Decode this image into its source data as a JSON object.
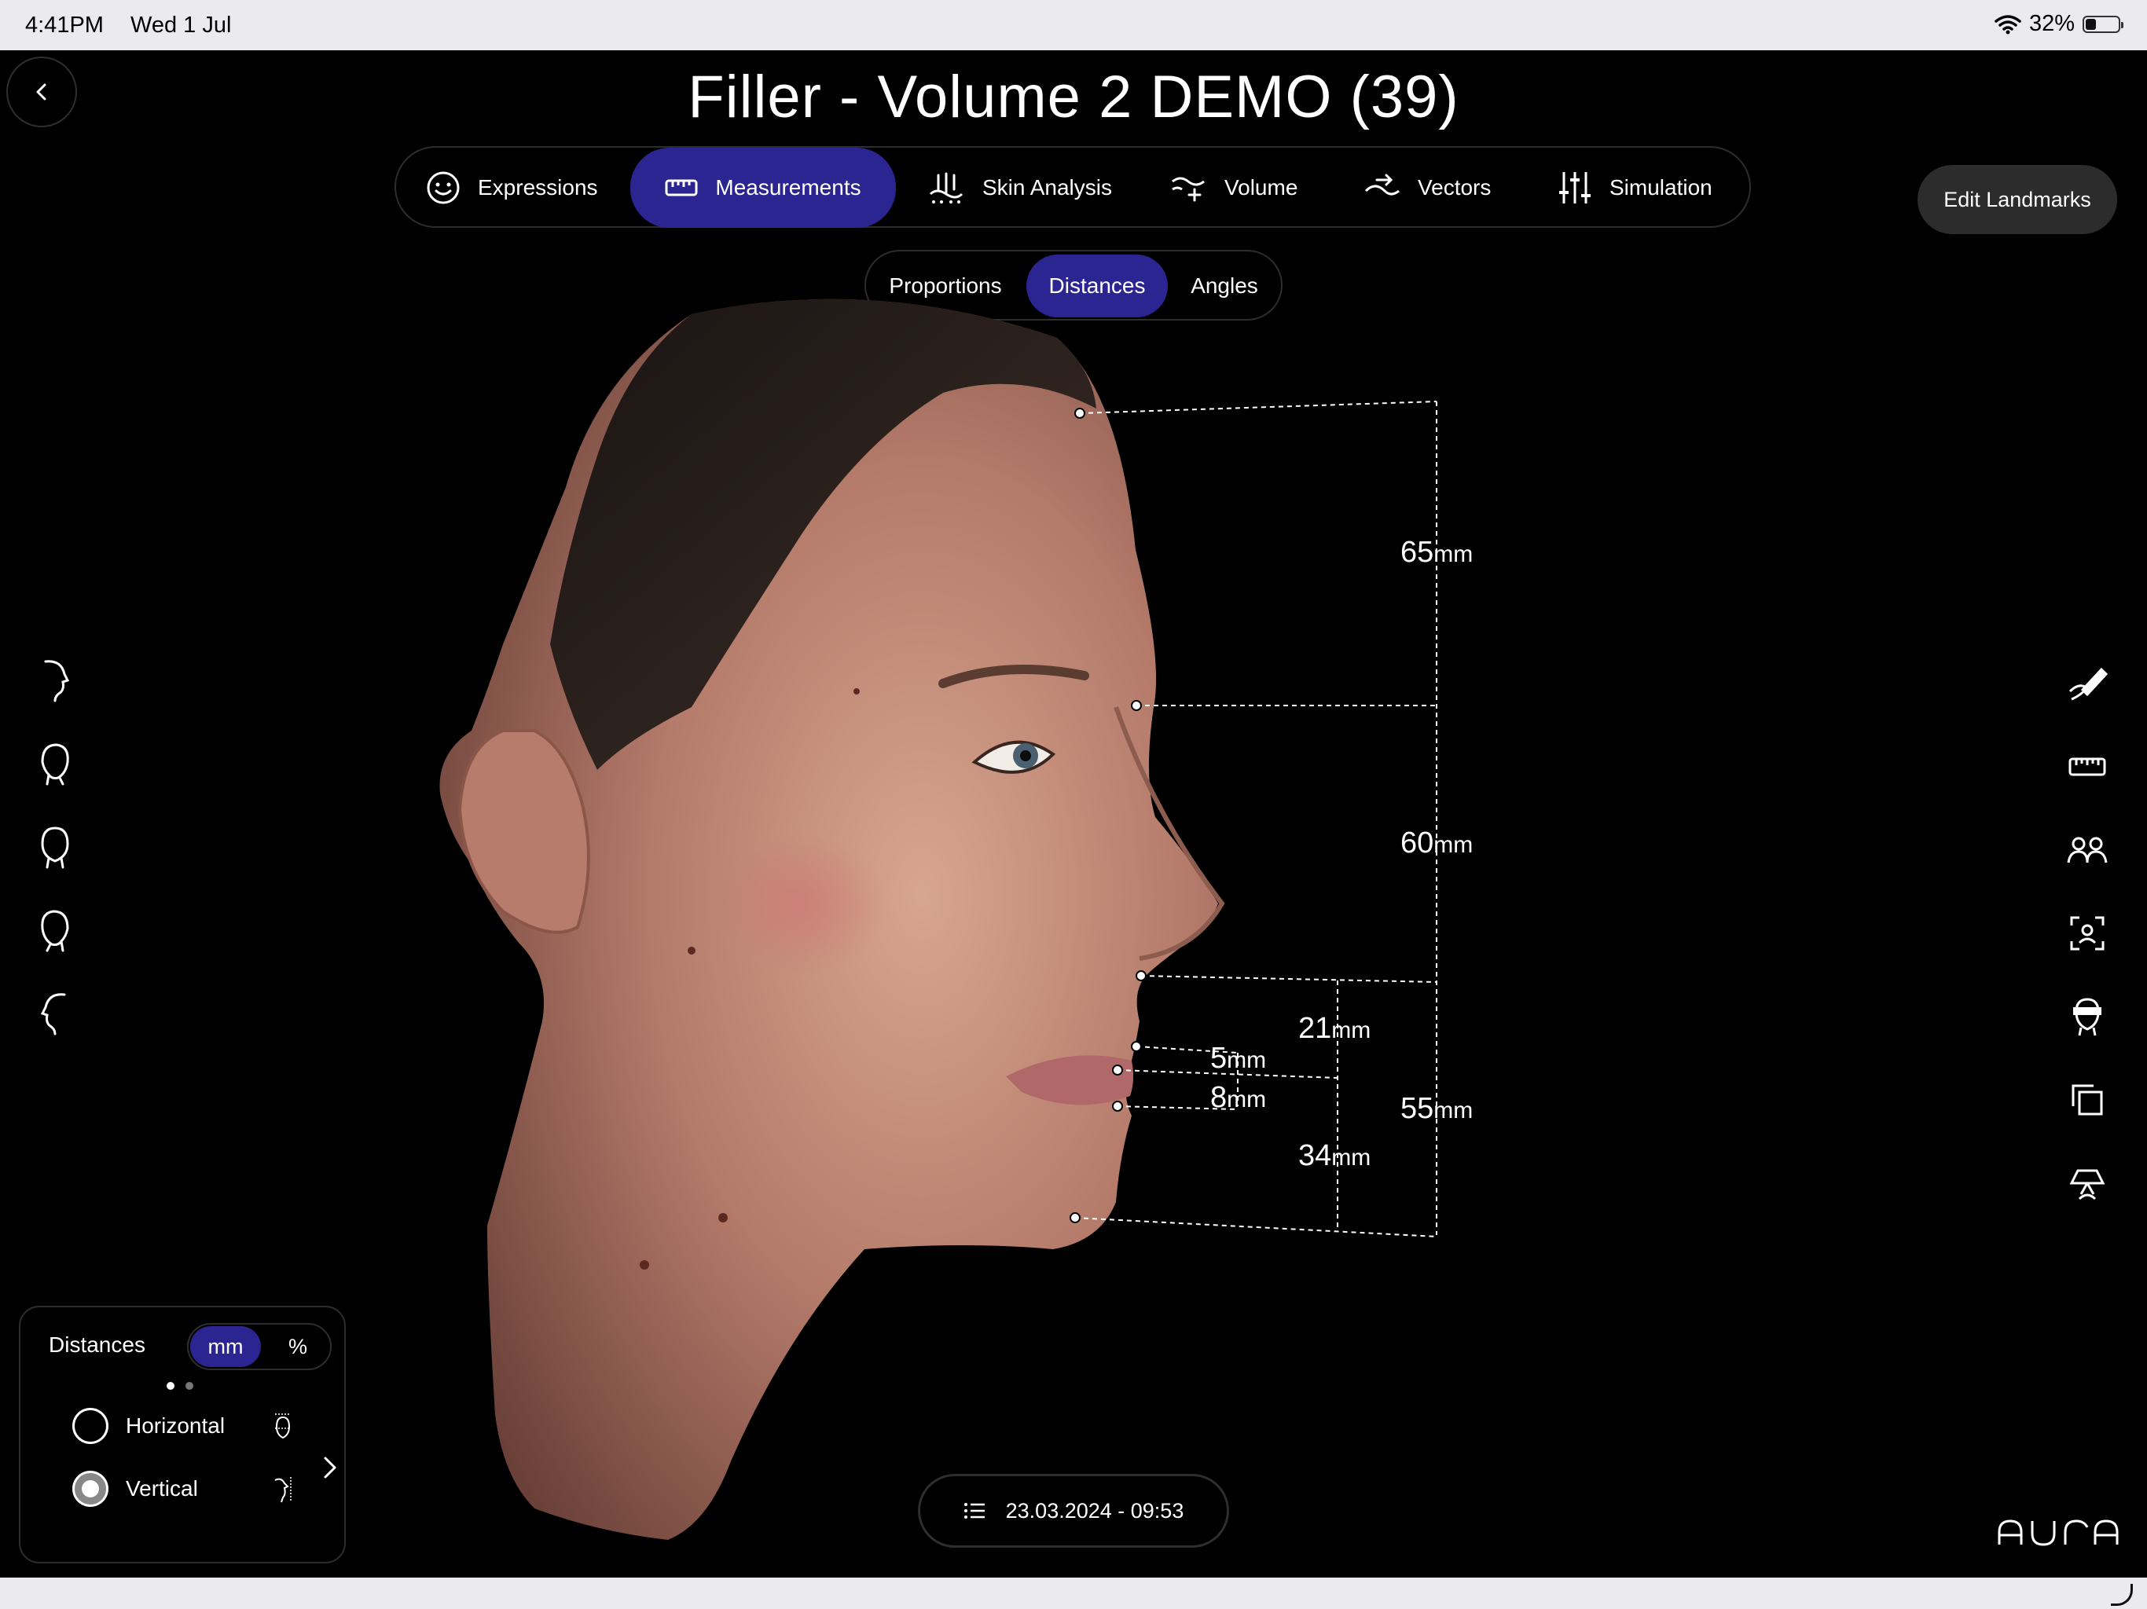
{
  "status_bar": {
    "time": "4:41PM",
    "date": "Wed 1 Jul",
    "battery_text": "32%",
    "battery_level": 0.32
  },
  "header": {
    "title": "Filler - Volume 2 DEMO (39)"
  },
  "main_tabs": [
    {
      "label": "Expressions",
      "icon": "smiley-icon",
      "active": false
    },
    {
      "label": "Measurements",
      "icon": "ruler-icon",
      "active": true
    },
    {
      "label": "Skin Analysis",
      "icon": "skin-analysis-icon",
      "active": false
    },
    {
      "label": "Volume",
      "icon": "volume-icon",
      "active": false
    },
    {
      "label": "Vectors",
      "icon": "vectors-icon",
      "active": false
    },
    {
      "label": "Simulation",
      "icon": "sliders-icon",
      "active": false
    }
  ],
  "edit_landmarks_label": "Edit Landmarks",
  "sub_tabs": [
    {
      "label": "Proportions",
      "active": false
    },
    {
      "label": "Distances",
      "active": true
    },
    {
      "label": "Angles",
      "active": false
    }
  ],
  "measurements": [
    {
      "value": "65",
      "unit": "mm"
    },
    {
      "value": "60",
      "unit": "mm"
    },
    {
      "value": "21",
      "unit": "mm"
    },
    {
      "value": "5",
      "unit": "mm"
    },
    {
      "value": "8",
      "unit": "mm"
    },
    {
      "value": "55",
      "unit": "mm"
    },
    {
      "value": "34",
      "unit": "mm"
    }
  ],
  "left_views": [
    "profile-right-icon",
    "three-quarter-right-icon",
    "front-face-icon",
    "three-quarter-left-icon",
    "profile-left-icon"
  ],
  "right_tools": [
    "draw-icon",
    "ruler-icon",
    "compare-people-icon",
    "face-scan-icon",
    "face-mask-icon",
    "copy-icon",
    "lamp-icon"
  ],
  "distances_panel": {
    "title": "Distances",
    "units": [
      {
        "label": "mm",
        "active": true
      },
      {
        "label": "%",
        "active": false
      }
    ],
    "options": [
      {
        "label": "Horizontal",
        "checked": false
      },
      {
        "label": "Vertical",
        "checked": true
      }
    ]
  },
  "session": {
    "datetime": "23.03.2024 - 09:53"
  },
  "brand": "AURA",
  "colors": {
    "accent": "#2b2592",
    "pill_dark": "#2c2c2c",
    "border": "#2d2d2d"
  }
}
